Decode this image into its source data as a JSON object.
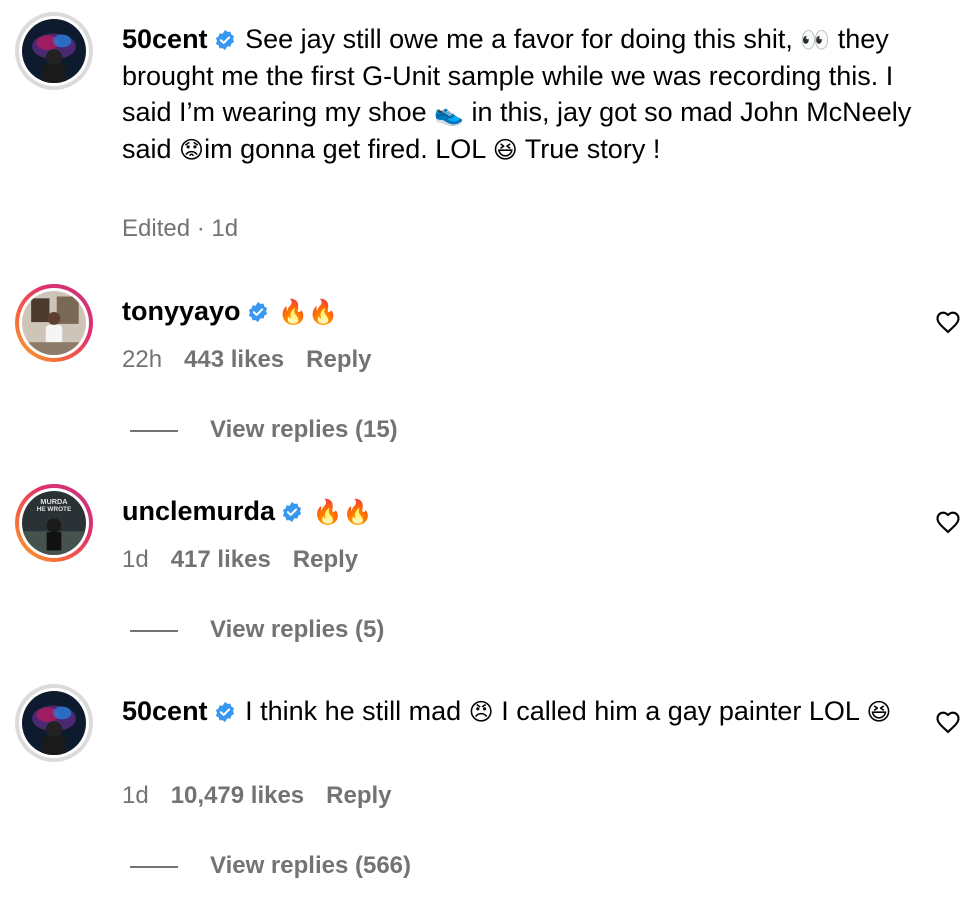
{
  "comments": [
    {
      "username": "50cent",
      "verified": true,
      "text_parts": [
        "See jay still owe me a favor for doing this shit, ",
        "👀",
        " they brought me the first G-Unit sample while we was recording this. I said I’m wearing my shoe ",
        "👟",
        " in this, jay got so mad John McNeely said ",
        "😟",
        "im gonna get fired. LOL ",
        "😆",
        " True story !"
      ],
      "meta": "Edited · 1d"
    },
    {
      "username": "tonyyayo",
      "verified": true,
      "text": "🔥🔥",
      "time": "22h",
      "likes": "443 likes",
      "reply": "Reply",
      "view_replies": "View replies (15)"
    },
    {
      "username": "unclemurda",
      "verified": true,
      "text": "🔥🔥",
      "time": "1d",
      "likes": "417 likes",
      "reply": "Reply",
      "view_replies": "View replies (5)",
      "avatar_text": "MURDA HE WROTE"
    },
    {
      "username": "50cent",
      "verified": true,
      "text_parts": [
        "I think he still mad ",
        "😠",
        " I called him a gay painter LOL ",
        "😆"
      ],
      "time": "1d",
      "likes": "10,479 likes",
      "reply": "Reply",
      "view_replies": "View replies (566)"
    }
  ],
  "colors": {
    "verified": "#3897f0",
    "meta": "#737373"
  },
  "icons": {
    "verified": "verified-badge-icon",
    "heart": "heart-outline-icon"
  }
}
